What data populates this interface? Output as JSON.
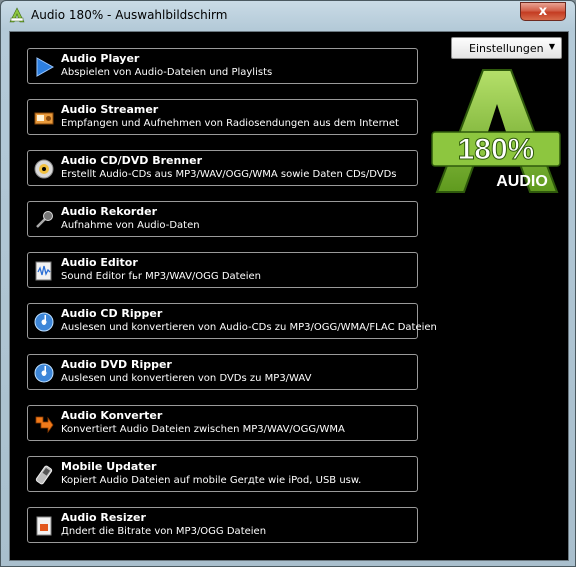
{
  "window": {
    "title": "Audio 180% - Auswahlbildschirm",
    "close_label": "x"
  },
  "settings": {
    "label": "Einstellungen"
  },
  "logo": {
    "percent_text": "180%",
    "word": "AUDIO"
  },
  "items": [
    {
      "title": "Audio Player",
      "desc": "Abspielen von Audio-Dateien und Playlists",
      "icon": "play-icon"
    },
    {
      "title": "Audio Streamer",
      "desc": "Empfangen und Aufnehmen von Radiosendungen aus dem Internet",
      "icon": "radio-icon"
    },
    {
      "title": "Audio CD/DVD Brenner",
      "desc": "Erstellt Audio-CDs aus MP3/WAV/OGG/WMA sowie Daten CDs/DVDs",
      "icon": "disc-icon"
    },
    {
      "title": "Audio Rekorder",
      "desc": "Aufnahme von Audio-Daten",
      "icon": "microphone-icon"
    },
    {
      "title": "Audio Editor",
      "desc": "Sound Editor fьr MP3/WAV/OGG Dateien",
      "icon": "editor-icon"
    },
    {
      "title": "Audio CD Ripper",
      "desc": "Auslesen und konvertieren von Audio-CDs zu MP3/OGG/WMA/FLAC Dateien",
      "icon": "cd-music-icon"
    },
    {
      "title": "Audio DVD Ripper",
      "desc": "Auslesen und konvertieren von DVDs zu MP3/WAV",
      "icon": "dvd-music-icon"
    },
    {
      "title": "Audio Konverter",
      "desc": "Konvertiert Audio Dateien zwischen MP3/WAV/OGG/WMA",
      "icon": "convert-arrow-icon"
    },
    {
      "title": "Mobile Updater",
      "desc": "Kopiert Audio Dateien auf mobile Gerдte wie iPod, USB usw.",
      "icon": "mobile-device-icon"
    },
    {
      "title": "Audio Resizer",
      "desc": "Дndert die Bitrate von MP3/OGG Dateien",
      "icon": "resize-file-icon"
    }
  ],
  "colors": {
    "background": "#000000",
    "item_border": "#9a9a9a",
    "logo_green": "#8dc63f",
    "text": "#ffffff"
  }
}
